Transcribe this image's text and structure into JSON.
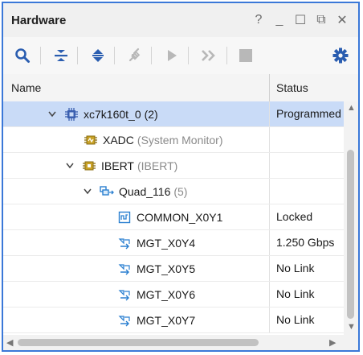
{
  "window": {
    "title": "Hardware",
    "controls": [
      "?",
      "_",
      "☐",
      "⧉",
      "✕"
    ]
  },
  "toolbar": {
    "buttons": [
      {
        "icon": "search-icon",
        "enabled": true
      },
      {
        "icon": "collapse-all-icon",
        "enabled": true
      },
      {
        "icon": "expand-all-icon",
        "enabled": true
      },
      {
        "icon": "auto-connect-icon",
        "enabled": false
      },
      {
        "icon": "run-icon",
        "enabled": false
      },
      {
        "icon": "fast-forward-icon",
        "enabled": false
      },
      {
        "icon": "stop-icon",
        "enabled": false
      },
      {
        "icon": "gear-icon",
        "enabled": true
      }
    ]
  },
  "table": {
    "columns": {
      "name": "Name",
      "status": "Status"
    },
    "rows": [
      {
        "name": "xc7k160t_0",
        "suffix": "(2)",
        "status": "Programmed",
        "icon": "chip-icon",
        "expand": "expanded",
        "selected": true
      },
      {
        "name": "XADC",
        "suffix": "(System Monitor)",
        "status": "",
        "icon": "sysmon-icon",
        "expand": "none",
        "selected": false
      },
      {
        "name": "IBERT",
        "suffix": "(IBERT)",
        "status": "",
        "icon": "ibert-icon",
        "expand": "expanded",
        "selected": false
      },
      {
        "name": "Quad_116",
        "suffix": "(5)",
        "status": "",
        "icon": "quad-icon",
        "expand": "expanded",
        "selected": false
      },
      {
        "name": "COMMON_X0Y1",
        "suffix": "",
        "status": "Locked",
        "icon": "common-icon",
        "expand": "none",
        "selected": false
      },
      {
        "name": "MGT_X0Y4",
        "suffix": "",
        "status": "1.250 Gbps",
        "icon": "mgt-icon",
        "expand": "none",
        "selected": false
      },
      {
        "name": "MGT_X0Y5",
        "suffix": "",
        "status": "No Link",
        "icon": "mgt-icon",
        "expand": "none",
        "selected": false
      },
      {
        "name": "MGT_X0Y6",
        "suffix": "",
        "status": "No Link",
        "icon": "mgt-icon",
        "expand": "none",
        "selected": false
      },
      {
        "name": "MGT_X0Y7",
        "suffix": "",
        "status": "No Link",
        "icon": "mgt-icon",
        "expand": "none",
        "selected": false
      }
    ]
  },
  "colors": {
    "accent": "#3a78d8",
    "selection": "#c9dbf7",
    "icon_blue": "#2a5db0",
    "icon_disabled": "#b8b8b8"
  }
}
